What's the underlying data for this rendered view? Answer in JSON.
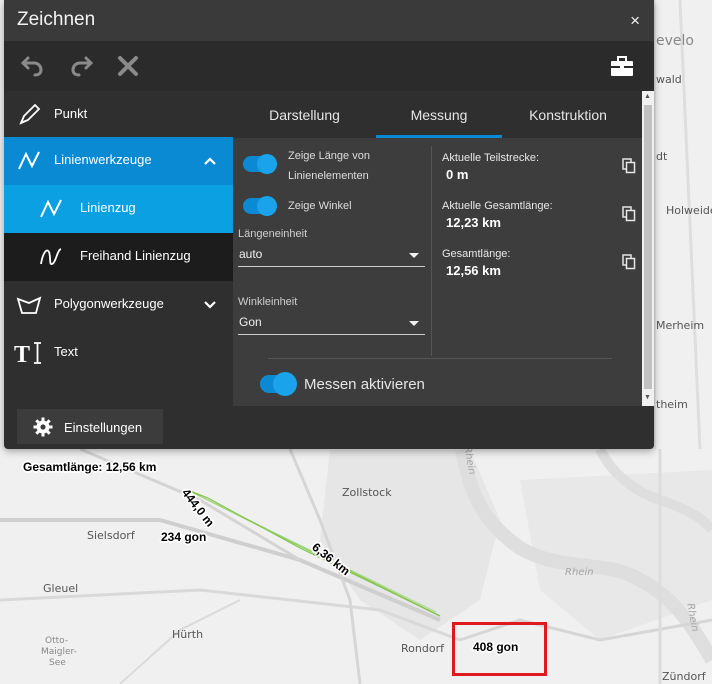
{
  "panel": {
    "title": "Zeichnen",
    "close_glyph": "×",
    "toolbar": [
      {
        "name": "undo-icon"
      },
      {
        "name": "redo-icon"
      },
      {
        "name": "delete-icon"
      },
      {
        "name": "toolbox-icon"
      }
    ],
    "sidebar": {
      "items": [
        {
          "label": "Punkt",
          "icon": "pencil-icon"
        },
        {
          "label": "Linienwerkzeuge",
          "icon": "line-icon",
          "expanded": true
        },
        {
          "label": "Linienzug",
          "icon": "polyline-icon",
          "selected": true
        },
        {
          "label": "Freihand Linienzug",
          "icon": "freehand-icon"
        },
        {
          "label": "Polygonwerkzeuge",
          "icon": "polygon-icon",
          "expanded": false
        },
        {
          "label": "Text",
          "icon": "text-icon"
        }
      ]
    },
    "tabs": [
      {
        "label": "Darstellung"
      },
      {
        "label": "Messung",
        "active": true
      },
      {
        "label": "Konstruktion"
      }
    ],
    "options": {
      "show_length_line1": "Zeige Länge von",
      "show_length_line2": "Linienelementen",
      "show_angle": "Zeige Winkel",
      "length_unit_label": "Längeneinheit",
      "length_unit_value": "auto",
      "angle_unit_label": "Winkleinheit",
      "angle_unit_value": "Gon"
    },
    "measurements": [
      {
        "label": "Aktuelle Teilstrecke:",
        "value": "0 m"
      },
      {
        "label": "Aktuelle Gesamtlänge:",
        "value": "12,23 km"
      },
      {
        "label": "Gesamtlänge:",
        "value": "12,56 km"
      }
    ],
    "measure_toggle_label": "Messen aktivieren",
    "settings_label": "Einstellungen"
  },
  "map": {
    "places": [
      "Zollstock",
      "Sielsdorf",
      "Gleuel",
      "Hürth",
      "Rondorf",
      "Zündorf",
      "Holweide",
      "Merheim",
      "Otto-",
      "Maigler-",
      "See"
    ],
    "edge_labels": [
      "evelo",
      "wald",
      "dt",
      "theim"
    ],
    "rivers": [
      "Rhein",
      "Rhein",
      "Rhein"
    ],
    "annotations": {
      "total_length": "Gesamtlänge: 12,56 km",
      "segment1": "444,0 m",
      "segment2": "6,36 km",
      "angle1": "234 gon",
      "angle2": "408 gon"
    }
  },
  "colors": {
    "accent": "#0b8ad4",
    "panel_bg": "#2f2f2f",
    "highlight": "#e0191f",
    "measure_line": "#8fce5a"
  }
}
